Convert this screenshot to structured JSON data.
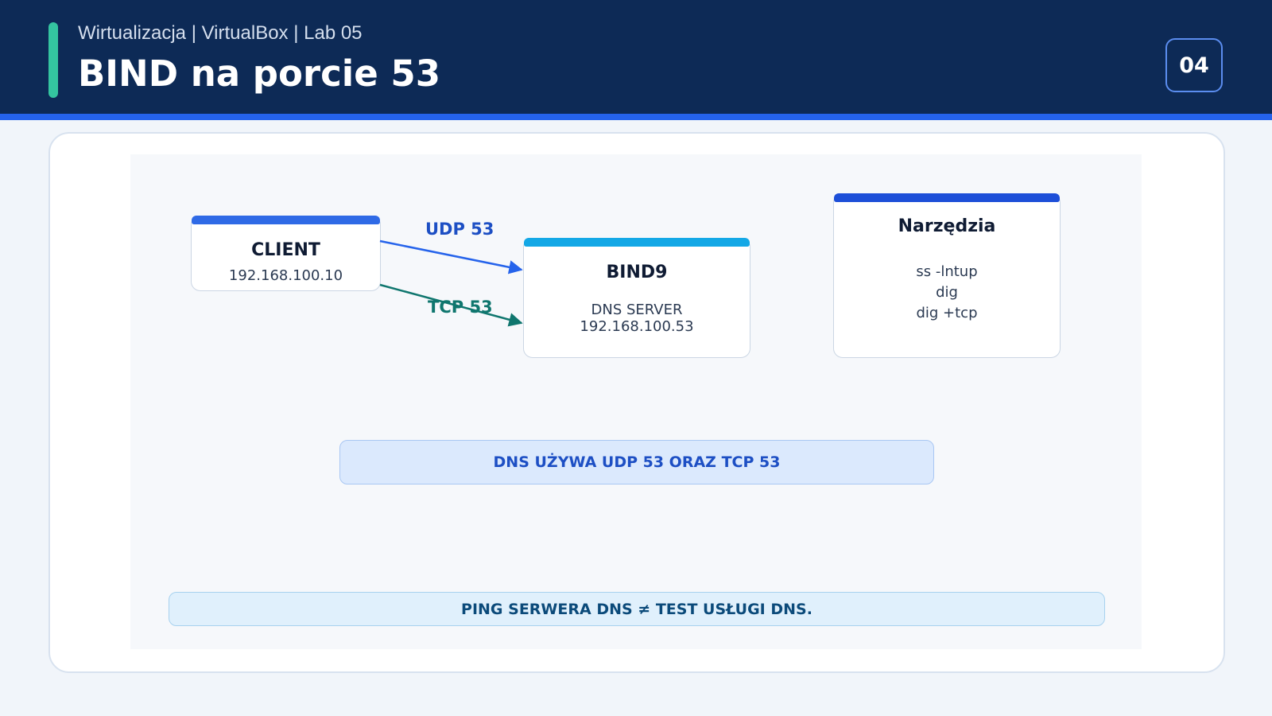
{
  "header": {
    "subtitle": "Wirtualizacja | VirtualBox | Lab 05",
    "title": "BIND na porcie 53",
    "page_number": "04"
  },
  "colors": {
    "header_bg": "#0d2a56",
    "accent_green": "#34c4a0",
    "accent_blue": "#2563eb",
    "udp_arrow": "#2563eb",
    "tcp_arrow": "#0f766e"
  },
  "diagram": {
    "client": {
      "title": "CLIENT",
      "ip": "192.168.100.10"
    },
    "server": {
      "title": "BIND9",
      "role": "DNS SERVER",
      "ip": "192.168.100.53"
    },
    "tools": {
      "title": "Narzędzia",
      "items": [
        "ss -lntup",
        "dig",
        "dig +tcp"
      ]
    },
    "links": {
      "udp_label": "UDP 53",
      "tcp_label": "TCP 53"
    },
    "callouts": {
      "protocols": "DNS UŻYWA UDP 53 ORAZ TCP 53",
      "warning": "PING SERWERA DNS ≠ TEST USŁUGI DNS."
    }
  }
}
